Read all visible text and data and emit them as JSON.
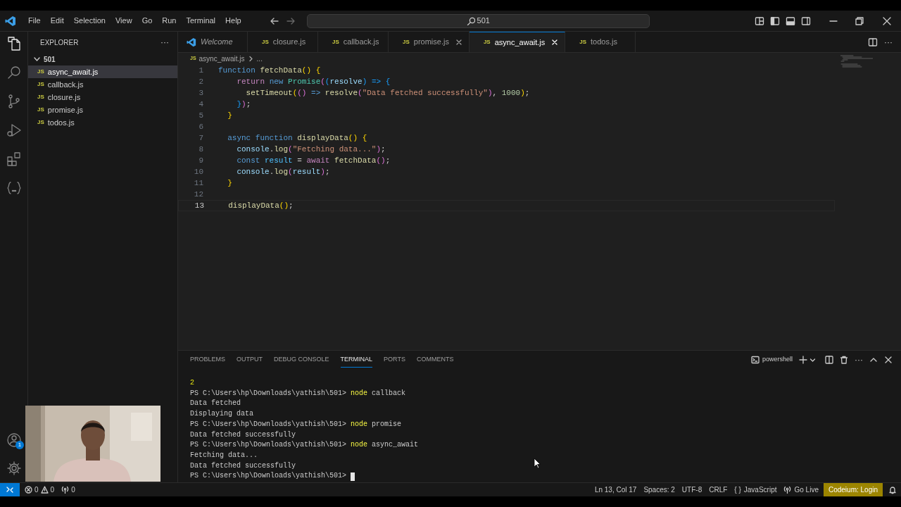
{
  "menu": [
    "File",
    "Edit",
    "Selection",
    "View",
    "Go",
    "Run",
    "Terminal",
    "Help"
  ],
  "search": {
    "value": "501"
  },
  "sidebar": {
    "title": "EXPLORER",
    "more": "···",
    "folder": {
      "name": "501",
      "expanded": true,
      "files": [
        {
          "icon": "JS",
          "name": "async_await.js",
          "selected": true
        },
        {
          "icon": "JS",
          "name": "callback.js",
          "selected": false
        },
        {
          "icon": "JS",
          "name": "closure.js",
          "selected": false
        },
        {
          "icon": "JS",
          "name": "promise.js",
          "selected": false
        },
        {
          "icon": "JS",
          "name": "todos.js",
          "selected": false
        }
      ]
    }
  },
  "account_badge": "1",
  "tabs": [
    {
      "kind": "welcome",
      "label": "Welcome",
      "selected": false,
      "close_button": false
    },
    {
      "kind": "js",
      "icon": "JS",
      "label": "closure.js",
      "selected": false,
      "close_button": false
    },
    {
      "kind": "js",
      "icon": "JS",
      "label": "callback.js",
      "selected": false,
      "close_button": false
    },
    {
      "kind": "js",
      "icon": "JS",
      "label": "promise.js",
      "selected": false,
      "close_button": true
    },
    {
      "kind": "js",
      "icon": "JS",
      "label": "async_await.js",
      "selected": true,
      "close_button": true
    },
    {
      "kind": "js",
      "icon": "JS",
      "label": "todos.js",
      "selected": false,
      "close_button": false
    }
  ],
  "breadcrumb": {
    "icon": "JS",
    "file": "async_await.js",
    "rest": "..."
  },
  "code": {
    "lines": [
      {
        "number": "1",
        "current": false,
        "tokens": [
          {
            "text": "function ",
            "kind": "keyword"
          },
          {
            "text": "fetchData",
            "kind": "function"
          },
          {
            "text": "() {",
            "kind": "bracket1"
          }
        ]
      },
      {
        "number": "2",
        "current": false,
        "tokens": [
          {
            "text": "    return ",
            "kind": "control"
          },
          {
            "text": "new ",
            "kind": "keyword"
          },
          {
            "text": "Promise",
            "kind": "class"
          },
          {
            "text": "(",
            "kind": "bracket2"
          },
          {
            "text": "(",
            "kind": "bracket3"
          },
          {
            "text": "resolve",
            "kind": "variable"
          },
          {
            "text": ") => {",
            "kind": "bracket3"
          }
        ]
      },
      {
        "number": "3",
        "current": false,
        "tokens": [
          {
            "text": "      setTimeout",
            "kind": "function"
          },
          {
            "text": "(",
            "kind": "bracket1"
          },
          {
            "text": "()",
            "kind": "bracket2"
          },
          {
            "text": " => ",
            "kind": "keyword"
          },
          {
            "text": "resolve",
            "kind": "function"
          },
          {
            "text": "(",
            "kind": "bracket2"
          },
          {
            "text": "\"Data fetched successfully\"",
            "kind": "string"
          },
          {
            "text": ")",
            "kind": "bracket2"
          },
          {
            "text": ", ",
            "kind": "plain"
          },
          {
            "text": "1000",
            "kind": "number"
          },
          {
            "text": ")",
            "kind": "bracket1"
          },
          {
            "text": ";",
            "kind": "plain"
          }
        ]
      },
      {
        "number": "4",
        "current": false,
        "tokens": [
          {
            "text": "    }",
            "kind": "bracket3"
          },
          {
            "text": ")",
            "kind": "bracket2"
          },
          {
            "text": ";",
            "kind": "plain"
          }
        ]
      },
      {
        "number": "5",
        "current": false,
        "tokens": [
          {
            "text": "  }",
            "kind": "bracket1"
          }
        ]
      },
      {
        "number": "6",
        "current": false
      },
      {
        "number": "7",
        "current": false,
        "tokens": [
          {
            "text": "  async ",
            "kind": "keyword"
          },
          {
            "text": "function ",
            "kind": "keyword"
          },
          {
            "text": "displayData",
            "kind": "function"
          },
          {
            "text": "() {",
            "kind": "bracket1"
          }
        ]
      },
      {
        "number": "8",
        "current": false,
        "tokens": [
          {
            "text": "    console",
            "kind": "variable"
          },
          {
            "text": ".",
            "kind": "plain"
          },
          {
            "text": "log",
            "kind": "function"
          },
          {
            "text": "(",
            "kind": "bracket2"
          },
          {
            "text": "\"Fetching data...\"",
            "kind": "string"
          },
          {
            "text": ")",
            "kind": "bracket2"
          },
          {
            "text": ";",
            "kind": "plain"
          }
        ]
      },
      {
        "number": "9",
        "current": false,
        "tokens": [
          {
            "text": "    const ",
            "kind": "keyword"
          },
          {
            "text": "result",
            "kind": "constant"
          },
          {
            "text": " = ",
            "kind": "plain"
          },
          {
            "text": "await ",
            "kind": "control"
          },
          {
            "text": "fetchData",
            "kind": "function"
          },
          {
            "text": "()",
            "kind": "bracket2"
          },
          {
            "text": ";",
            "kind": "plain"
          }
        ]
      },
      {
        "number": "10",
        "current": false,
        "tokens": [
          {
            "text": "    console",
            "kind": "variable"
          },
          {
            "text": ".",
            "kind": "plain"
          },
          {
            "text": "log",
            "kind": "function"
          },
          {
            "text": "(",
            "kind": "bracket2"
          },
          {
            "text": "result",
            "kind": "variable"
          },
          {
            "text": ")",
            "kind": "bracket2"
          },
          {
            "text": ";",
            "kind": "plain"
          }
        ]
      },
      {
        "number": "11",
        "current": false,
        "tokens": [
          {
            "text": "  }",
            "kind": "bracket1"
          }
        ]
      },
      {
        "number": "12",
        "current": false
      },
      {
        "number": "13",
        "current": true,
        "tokens": [
          {
            "text": "  displayData",
            "kind": "function"
          },
          {
            "text": "()",
            "kind": "bracket1"
          },
          {
            "text": ";",
            "kind": "plain"
          }
        ]
      }
    ]
  },
  "panel": {
    "tabs": [
      {
        "label": "PROBLEMS",
        "selected": false
      },
      {
        "label": "OUTPUT",
        "selected": false
      },
      {
        "label": "DEBUG CONSOLE",
        "selected": false
      },
      {
        "label": "TERMINAL",
        "selected": true
      },
      {
        "label": "PORTS",
        "selected": false
      },
      {
        "label": "COMMENTS",
        "selected": false
      }
    ],
    "shell": "powershell",
    "terminal": [
      {
        "cursor": false,
        "tokens": [
          {
            "text": "2",
            "kind": "number"
          }
        ]
      },
      {
        "cursor": false,
        "tokens": [
          {
            "text": "PS C:\\Users\\hp\\Downloads\\yathish\\501> ",
            "kind": "prompt"
          },
          {
            "text": "node",
            "kind": "command"
          },
          {
            "text": " callback",
            "kind": "argument"
          }
        ]
      },
      {
        "cursor": false,
        "tokens": [
          {
            "text": "Data fetched",
            "kind": "output"
          }
        ]
      },
      {
        "cursor": false,
        "tokens": [
          {
            "text": "Displaying data",
            "kind": "output"
          }
        ]
      },
      {
        "cursor": false,
        "tokens": [
          {
            "text": "PS C:\\Users\\hp\\Downloads\\yathish\\501> ",
            "kind": "prompt"
          },
          {
            "text": "node",
            "kind": "command"
          },
          {
            "text": " promise",
            "kind": "argument"
          }
        ]
      },
      {
        "cursor": false,
        "tokens": [
          {
            "text": "Data fetched successfully",
            "kind": "output"
          }
        ]
      },
      {
        "cursor": false,
        "tokens": [
          {
            "text": "PS C:\\Users\\hp\\Downloads\\yathish\\501> ",
            "kind": "prompt"
          },
          {
            "text": "node",
            "kind": "command"
          },
          {
            "text": " async_await",
            "kind": "argument"
          }
        ]
      },
      {
        "cursor": false,
        "tokens": [
          {
            "text": "Fetching data...",
            "kind": "output"
          }
        ]
      },
      {
        "cursor": false,
        "tokens": [
          {
            "text": "Data fetched successfully",
            "kind": "output"
          }
        ]
      },
      {
        "cursor": true,
        "tokens": [
          {
            "text": "PS C:\\Users\\hp\\Downloads\\yathish\\501>",
            "kind": "prompt"
          }
        ]
      }
    ]
  },
  "status_bar": {
    "errors": "0",
    "warnings": "0",
    "ports": "0",
    "items": [
      {
        "kind": "plain",
        "text": "Ln 13, Col 17"
      },
      {
        "kind": "plain",
        "text": "Spaces: 2"
      },
      {
        "kind": "plain",
        "text": "UTF-8"
      },
      {
        "kind": "plain",
        "text": "CRLF"
      },
      {
        "kind": "language",
        "glyph": "{ }",
        "text": "JavaScript"
      },
      {
        "kind": "live",
        "text": "Go Live"
      },
      {
        "kind": "highlight",
        "text": "Codeium: Login"
      }
    ]
  }
}
